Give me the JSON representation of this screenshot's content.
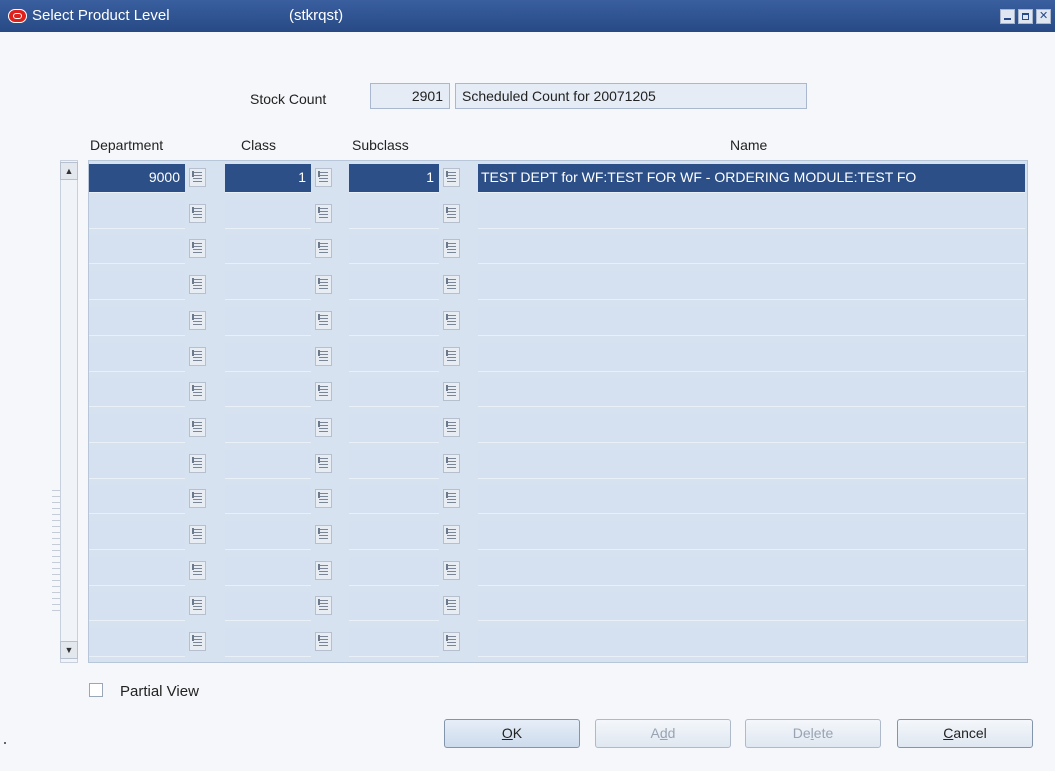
{
  "window": {
    "title": "Select Product Level",
    "module": "(stkrqst)"
  },
  "stock_count": {
    "label": "Stock Count",
    "number": "2901",
    "description": "Scheduled Count for 20071205"
  },
  "table": {
    "headers": {
      "department": "Department",
      "class": "Class",
      "subclass": "Subclass",
      "name": "Name"
    },
    "rows": [
      {
        "department": "9000",
        "class": "1",
        "subclass": "1",
        "name": "TEST DEPT for WF:TEST FOR WF - ORDERING MODULE:TEST FO",
        "selected": true
      },
      {
        "department": "",
        "class": "",
        "subclass": "",
        "name": ""
      },
      {
        "department": "",
        "class": "",
        "subclass": "",
        "name": ""
      },
      {
        "department": "",
        "class": "",
        "subclass": "",
        "name": ""
      },
      {
        "department": "",
        "class": "",
        "subclass": "",
        "name": ""
      },
      {
        "department": "",
        "class": "",
        "subclass": "",
        "name": ""
      },
      {
        "department": "",
        "class": "",
        "subclass": "",
        "name": ""
      },
      {
        "department": "",
        "class": "",
        "subclass": "",
        "name": ""
      },
      {
        "department": "",
        "class": "",
        "subclass": "",
        "name": ""
      },
      {
        "department": "",
        "class": "",
        "subclass": "",
        "name": ""
      },
      {
        "department": "",
        "class": "",
        "subclass": "",
        "name": ""
      },
      {
        "department": "",
        "class": "",
        "subclass": "",
        "name": ""
      },
      {
        "department": "",
        "class": "",
        "subclass": "",
        "name": ""
      },
      {
        "department": "",
        "class": "",
        "subclass": "",
        "name": ""
      }
    ]
  },
  "partial_view": {
    "label": "Partial View",
    "checked": false
  },
  "buttons": {
    "ok": {
      "prefix": "",
      "mnemonic": "O",
      "suffix": "K"
    },
    "add": {
      "prefix": "A",
      "mnemonic": "d",
      "suffix": "d"
    },
    "delete": {
      "prefix": "De",
      "mnemonic": "l",
      "suffix": "ete"
    },
    "cancel": {
      "prefix": "",
      "mnemonic": "C",
      "suffix": "ancel"
    }
  },
  "icons": {
    "list_of_values": "lov-icon",
    "scroll_up": "scroll-up-arrow-icon",
    "scroll_down": "scroll-down-arrow-icon",
    "logo": "oracle-logo-icon"
  },
  "colors": {
    "titlebar": "#274a85",
    "selected_row": "#2c4f87",
    "grid_cell": "#d5e1f0"
  }
}
